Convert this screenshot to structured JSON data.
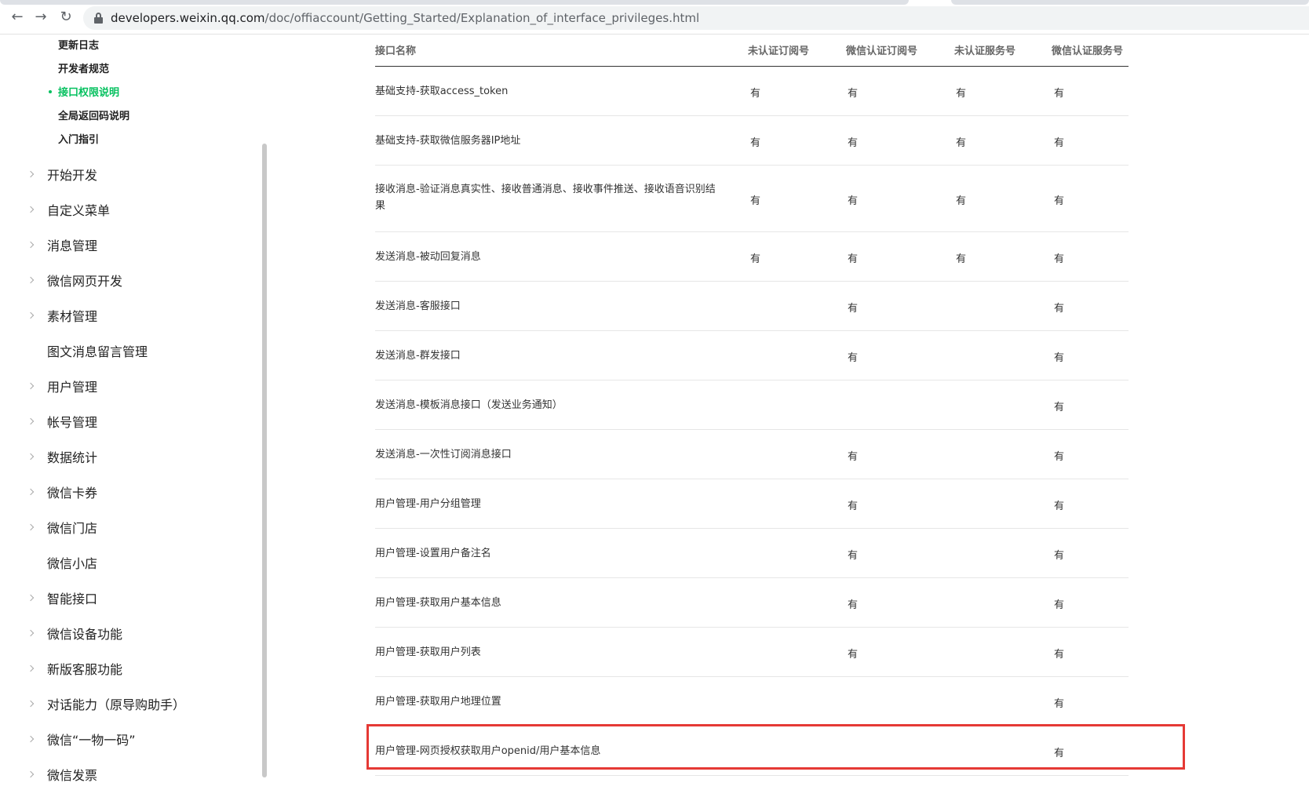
{
  "browser": {
    "url_host": "developers.weixin.qq.com",
    "url_path": "/doc/offiaccount/Getting_Started/Explanation_of_interface_privileges.html",
    "icons": [
      "back-icon",
      "forward-icon",
      "reload-icon",
      "lock-icon"
    ]
  },
  "sidebar": {
    "sub_items": [
      {
        "label": "更新日志",
        "active": false
      },
      {
        "label": "开发者规范",
        "active": false
      },
      {
        "label": "接口权限说明",
        "active": true
      },
      {
        "label": "全局返回码说明",
        "active": false
      },
      {
        "label": "入门指引",
        "active": false
      }
    ],
    "items": [
      {
        "label": "开始开发",
        "expandable": true
      },
      {
        "label": "自定义菜单",
        "expandable": true
      },
      {
        "label": "消息管理",
        "expandable": true
      },
      {
        "label": "微信网页开发",
        "expandable": true
      },
      {
        "label": "素材管理",
        "expandable": true
      },
      {
        "label": "图文消息留言管理",
        "expandable": false
      },
      {
        "label": "用户管理",
        "expandable": true
      },
      {
        "label": "帐号管理",
        "expandable": true
      },
      {
        "label": "数据统计",
        "expandable": true
      },
      {
        "label": "微信卡券",
        "expandable": true
      },
      {
        "label": "微信门店",
        "expandable": true
      },
      {
        "label": "微信小店",
        "expandable": false
      },
      {
        "label": "智能接口",
        "expandable": true
      },
      {
        "label": "微信设备功能",
        "expandable": true
      },
      {
        "label": "新版客服功能",
        "expandable": true
      },
      {
        "label": "对话能力（原导购助手）",
        "expandable": true
      },
      {
        "label": "微信“一物一码”",
        "expandable": true
      },
      {
        "label": "微信发票",
        "expandable": true
      }
    ]
  },
  "table": {
    "headers": [
      "接口名称",
      "未认证订阅号",
      "微信认证订阅号",
      "未认证服务号",
      "微信认证服务号"
    ],
    "rows": [
      {
        "name": "基础支持-获取access_token",
        "cols": [
          "有",
          "有",
          "有",
          "有"
        ]
      },
      {
        "name": "基础支持-获取微信服务器IP地址",
        "cols": [
          "有",
          "有",
          "有",
          "有"
        ]
      },
      {
        "name": "接收消息-验证消息真实性、接收普通消息、接收事件推送、接收语音识别结果",
        "cols": [
          "有",
          "有",
          "有",
          "有"
        ]
      },
      {
        "name": "发送消息-被动回复消息",
        "cols": [
          "有",
          "有",
          "有",
          "有"
        ]
      },
      {
        "name": "发送消息-客服接口",
        "cols": [
          "",
          "有",
          "",
          "有"
        ]
      },
      {
        "name": "发送消息-群发接口",
        "cols": [
          "",
          "有",
          "",
          "有"
        ]
      },
      {
        "name": "发送消息-模板消息接口（发送业务通知）",
        "cols": [
          "",
          "",
          "",
          "有"
        ]
      },
      {
        "name": "发送消息-一次性订阅消息接口",
        "cols": [
          "",
          "有",
          "",
          "有"
        ]
      },
      {
        "name": "用户管理-用户分组管理",
        "cols": [
          "",
          "有",
          "",
          "有"
        ]
      },
      {
        "name": "用户管理-设置用户备注名",
        "cols": [
          "",
          "有",
          "",
          "有"
        ]
      },
      {
        "name": "用户管理-获取用户基本信息",
        "cols": [
          "",
          "有",
          "",
          "有"
        ]
      },
      {
        "name": "用户管理-获取用户列表",
        "cols": [
          "",
          "有",
          "",
          "有"
        ]
      },
      {
        "name": "用户管理-获取用户地理位置",
        "cols": [
          "",
          "",
          "",
          "有"
        ]
      },
      {
        "name": "用户管理-网页授权获取用户openid/用户基本信息",
        "cols": [
          "",
          "",
          "",
          "有"
        ],
        "highlighted": true
      }
    ]
  },
  "colors": {
    "accent": "#07c160",
    "highlight": "#e53935"
  }
}
